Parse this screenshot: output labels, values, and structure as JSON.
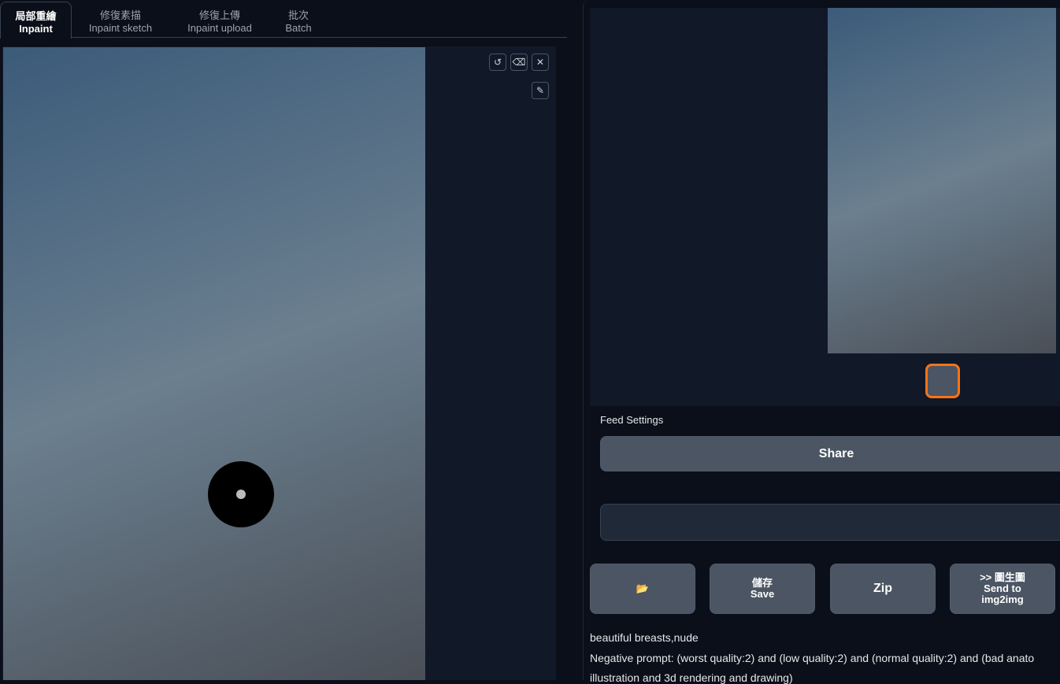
{
  "tabs": [
    {
      "zh": "局部重繪",
      "en": "Inpaint"
    },
    {
      "zh": "修復素描",
      "en": "Inpaint sketch"
    },
    {
      "zh": "修復上傳",
      "en": "Inpaint upload"
    },
    {
      "zh": "批次",
      "en": "Batch"
    }
  ],
  "canvas_tools": {
    "undo": "↺",
    "clear": "⌫",
    "close": "✕",
    "brush": "✎"
  },
  "feed_settings_label": "Feed Settings",
  "share_label": "Share",
  "buttons": {
    "folder": "📂",
    "save_zh": "儲存",
    "save_en": "Save",
    "zip": "Zip",
    "send_zh": ">> 圖生圖",
    "send_en1": "Send to",
    "send_en2": "img2img"
  },
  "prompt": "beautiful breasts,nude",
  "negative_prompt": "Negative prompt: (worst quality:2) and (low quality:2) and (normal quality:2) and (bad anato",
  "negative_prompt_cont": "illustration and 3d rendering and drawing)"
}
